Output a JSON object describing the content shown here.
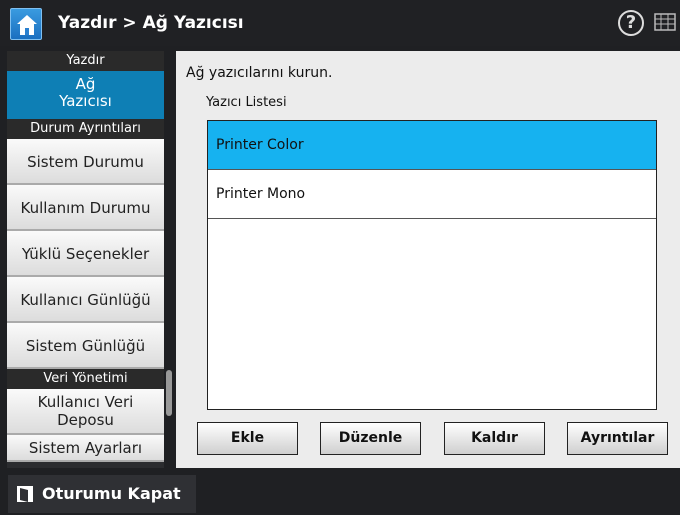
{
  "header": {
    "title": "Yazdır > Ağ Yazıcısı",
    "help": "?"
  },
  "sidebar": {
    "group_print": "Yazdır",
    "active_item": "Ağ\nYazıcısı",
    "group_status": "Durum Ayrıntıları",
    "items": [
      "Sistem Durumu",
      "Kullanım Durumu",
      "Yüklü Seçenekler",
      "Kullanıcı Günlüğü",
      "Sistem Günlüğü"
    ],
    "group_data": "Veri Yönetimi",
    "item_user_data": "Kullanıcı Veri Deposu",
    "item_system_settings": "Sistem Ayarları"
  },
  "main": {
    "instruction": "Ağ yazıcılarını kurun.",
    "list_label": "Yazıcı Listesi",
    "printers": [
      "Printer Color",
      "Printer Mono"
    ],
    "buttons": {
      "add": "Ekle",
      "edit": "Düzenle",
      "remove": "Kaldır",
      "details": "Ayrıntılar"
    }
  },
  "footer": {
    "logout": "Oturumu Kapat"
  },
  "colors": {
    "accent": "#0e7fb5",
    "selection": "#16b2f0"
  }
}
